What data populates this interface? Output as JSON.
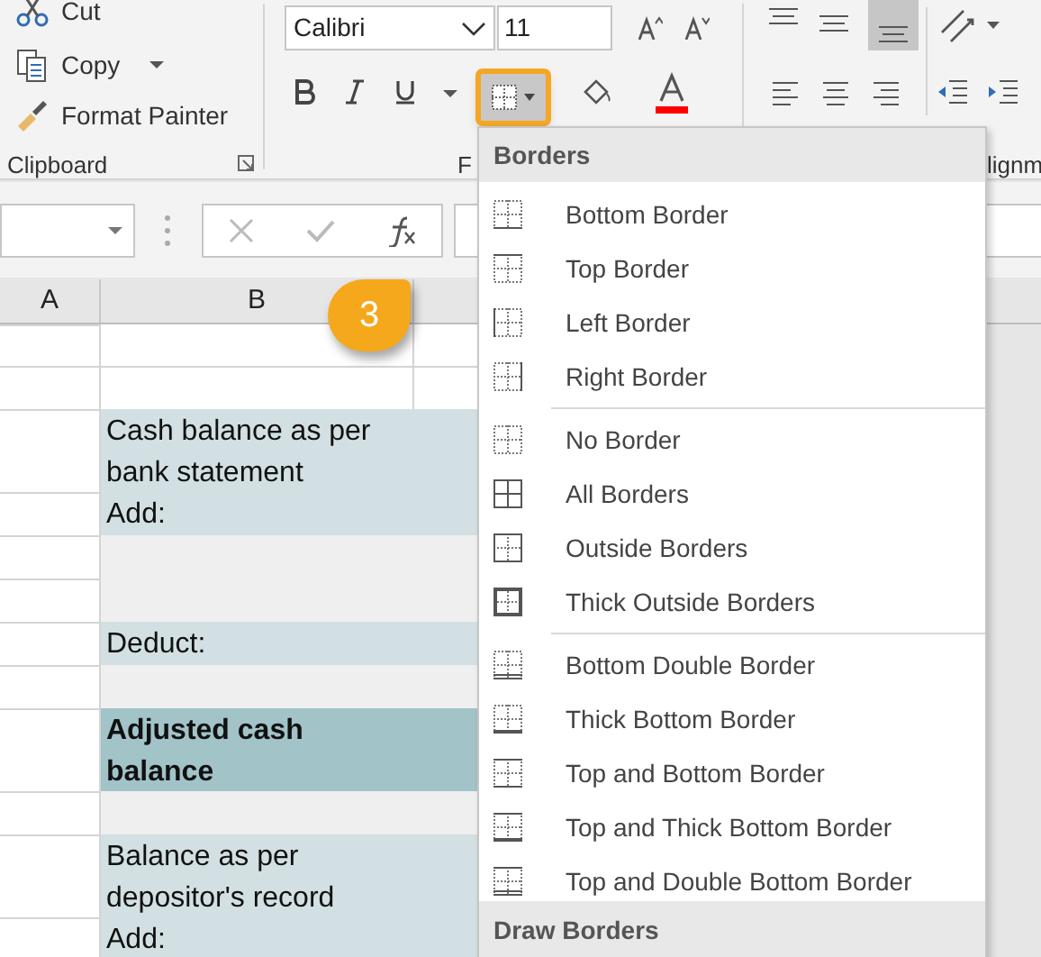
{
  "clipboard": {
    "items": [
      {
        "kind": "cut",
        "label": "Cut"
      },
      {
        "kind": "copy",
        "label": "Copy"
      },
      {
        "kind": "painter",
        "label": "Format Painter"
      }
    ],
    "group_label": "Clipboard"
  },
  "font": {
    "name": "Calibri",
    "size": "11",
    "group_label": "F"
  },
  "alignment": {
    "group_label": "lignm"
  },
  "callout": "3",
  "columns": [
    {
      "label": "A"
    },
    {
      "label": "B"
    }
  ],
  "cells": [
    {
      "kind": "empty"
    },
    {
      "kind": "empty"
    },
    {
      "kind": "label",
      "lines": [
        "Cash balance as per",
        "bank statement",
        "Add:"
      ]
    },
    {
      "kind": "blank"
    },
    {
      "kind": "label",
      "lines": [
        "Deduct:"
      ]
    },
    {
      "kind": "blank"
    },
    {
      "kind": "total",
      "lines": [
        "Adjusted cash",
        "balance"
      ]
    },
    {
      "kind": "blank"
    },
    {
      "kind": "label",
      "lines": [
        "Balance as per",
        "depositor's record",
        "Add:"
      ]
    }
  ],
  "menu": {
    "header": "Borders",
    "groups": [
      [
        {
          "kind": "bottom",
          "label": "Bottom Border"
        },
        {
          "kind": "top",
          "label": "Top Border"
        },
        {
          "kind": "left",
          "label": "Left Border"
        },
        {
          "kind": "right",
          "label": "Right Border"
        }
      ],
      [
        {
          "kind": "none",
          "label": "No Border"
        },
        {
          "kind": "all",
          "label": "All Borders"
        },
        {
          "kind": "outside",
          "label": "Outside Borders"
        },
        {
          "kind": "thick-outside",
          "label": "Thick Outside Borders"
        }
      ],
      [
        {
          "kind": "bottom-double",
          "label": "Bottom Double Border"
        },
        {
          "kind": "thick-bottom",
          "label": "Thick Bottom Border"
        },
        {
          "kind": "top-bottom",
          "label": "Top and Bottom Border"
        },
        {
          "kind": "top-thick-bottom",
          "label": "Top and Thick Bottom Border"
        },
        {
          "kind": "top-double-bottom",
          "label": "Top and Double Bottom Border"
        }
      ]
    ],
    "footer": "Draw Borders"
  }
}
